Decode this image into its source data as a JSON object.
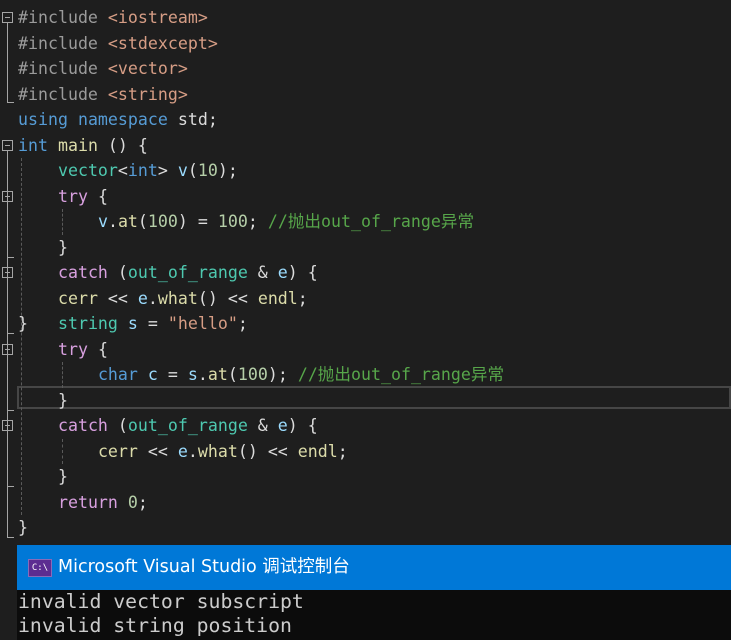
{
  "editor": {
    "lines": [
      [
        [
          "#include ",
          "pp"
        ],
        [
          "<iostream>",
          "inc"
        ]
      ],
      [
        [
          "#include ",
          "pp"
        ],
        [
          "<stdexcept>",
          "inc"
        ]
      ],
      [
        [
          "#include ",
          "pp"
        ],
        [
          "<vector>",
          "inc"
        ]
      ],
      [
        [
          "#include ",
          "pp"
        ],
        [
          "<string>",
          "inc"
        ]
      ],
      [
        [
          "using ",
          "kw"
        ],
        [
          "namespace ",
          "kw"
        ],
        [
          "std;",
          "pl"
        ]
      ],
      [
        [
          "int ",
          "kw"
        ],
        [
          "main ",
          "fn"
        ],
        [
          "() {",
          "pl"
        ]
      ],
      [
        [
          "    ",
          "pl"
        ],
        [
          "vector",
          "type"
        ],
        [
          "<",
          "pl"
        ],
        [
          "int",
          "kw"
        ],
        [
          "> ",
          "pl"
        ],
        [
          "v",
          "var"
        ],
        [
          "(",
          "pl"
        ],
        [
          "10",
          "num"
        ],
        [
          ");",
          "pl"
        ]
      ],
      [
        [
          "    ",
          "pl"
        ],
        [
          "try ",
          "ctl"
        ],
        [
          "{",
          "pl"
        ]
      ],
      [
        [
          "        ",
          "pl"
        ],
        [
          "v",
          "var"
        ],
        [
          ".",
          "pl"
        ],
        [
          "at",
          "fn"
        ],
        [
          "(",
          "pl"
        ],
        [
          "100",
          "num"
        ],
        [
          ") = ",
          "pl"
        ],
        [
          "100",
          "num"
        ],
        [
          "; ",
          "pl"
        ],
        [
          "//抛出out_of_range异常",
          "cm"
        ]
      ],
      [
        [
          "    ",
          "pl"
        ],
        [
          "}",
          "pl"
        ]
      ],
      [
        [
          "    ",
          "pl"
        ],
        [
          "catch ",
          "ctl"
        ],
        [
          "(",
          "pl"
        ],
        [
          "out_of_range",
          "type"
        ],
        [
          " & ",
          "pl"
        ],
        [
          "e",
          "var"
        ],
        [
          ") {",
          "pl"
        ]
      ],
      [
        [
          "    ",
          "pl"
        ],
        [
          "cerr",
          "fn"
        ],
        [
          " << ",
          "pl"
        ],
        [
          "e",
          "var"
        ],
        [
          ".",
          "pl"
        ],
        [
          "what",
          "fn"
        ],
        [
          "() << ",
          "pl"
        ],
        [
          "endl",
          "fn"
        ],
        [
          ";",
          "pl"
        ]
      ],
      [
        [
          "}   ",
          "pl"
        ],
        [
          "string ",
          "type"
        ],
        [
          "s",
          "var"
        ],
        [
          " = ",
          "pl"
        ],
        [
          "\"hello\"",
          "str"
        ],
        [
          ";",
          "pl"
        ]
      ],
      [
        [
          "    ",
          "pl"
        ],
        [
          "try ",
          "ctl"
        ],
        [
          "{",
          "pl"
        ]
      ],
      [
        [
          "        ",
          "pl"
        ],
        [
          "char ",
          "kw"
        ],
        [
          "c",
          "var"
        ],
        [
          " = ",
          "pl"
        ],
        [
          "s",
          "var"
        ],
        [
          ".",
          "pl"
        ],
        [
          "at",
          "fn"
        ],
        [
          "(",
          "pl"
        ],
        [
          "100",
          "num"
        ],
        [
          "); ",
          "pl"
        ],
        [
          "//抛出out_of_range异常",
          "cm"
        ]
      ],
      [
        [
          "    ",
          "pl"
        ],
        [
          "}",
          "pl"
        ]
      ],
      [
        [
          "    ",
          "pl"
        ],
        [
          "catch ",
          "ctl"
        ],
        [
          "(",
          "pl"
        ],
        [
          "out_of_range",
          "type"
        ],
        [
          " & ",
          "pl"
        ],
        [
          "e",
          "var"
        ],
        [
          ") {",
          "pl"
        ]
      ],
      [
        [
          "        ",
          "pl"
        ],
        [
          "cerr",
          "fn"
        ],
        [
          " << ",
          "pl"
        ],
        [
          "e",
          "var"
        ],
        [
          ".",
          "pl"
        ],
        [
          "what",
          "fn"
        ],
        [
          "() << ",
          "pl"
        ],
        [
          "endl",
          "fn"
        ],
        [
          ";",
          "pl"
        ]
      ],
      [
        [
          "    ",
          "pl"
        ],
        [
          "}",
          "pl"
        ]
      ],
      [
        [
          "    ",
          "pl"
        ],
        [
          "return ",
          "ctl"
        ],
        [
          "0",
          "num"
        ],
        [
          ";",
          "pl"
        ]
      ],
      [
        [
          "}",
          "pl"
        ]
      ]
    ],
    "colors": {
      "background": "#1e1e1e",
      "keyword": "#569cd6",
      "control": "#d8a0df",
      "type": "#4ec9b0",
      "function": "#dcdcaa",
      "number": "#b5cea8",
      "comment": "#57a64a",
      "string": "#d69d85",
      "preprocessor": "#9b9b9b"
    }
  },
  "console": {
    "icon": "console-app-icon",
    "icon_text": "C:\\",
    "title": "Microsoft Visual Studio 调试控制台",
    "output": [
      "invalid vector subscript",
      "invalid string position"
    ],
    "title_bar_color": "#0078d7"
  }
}
